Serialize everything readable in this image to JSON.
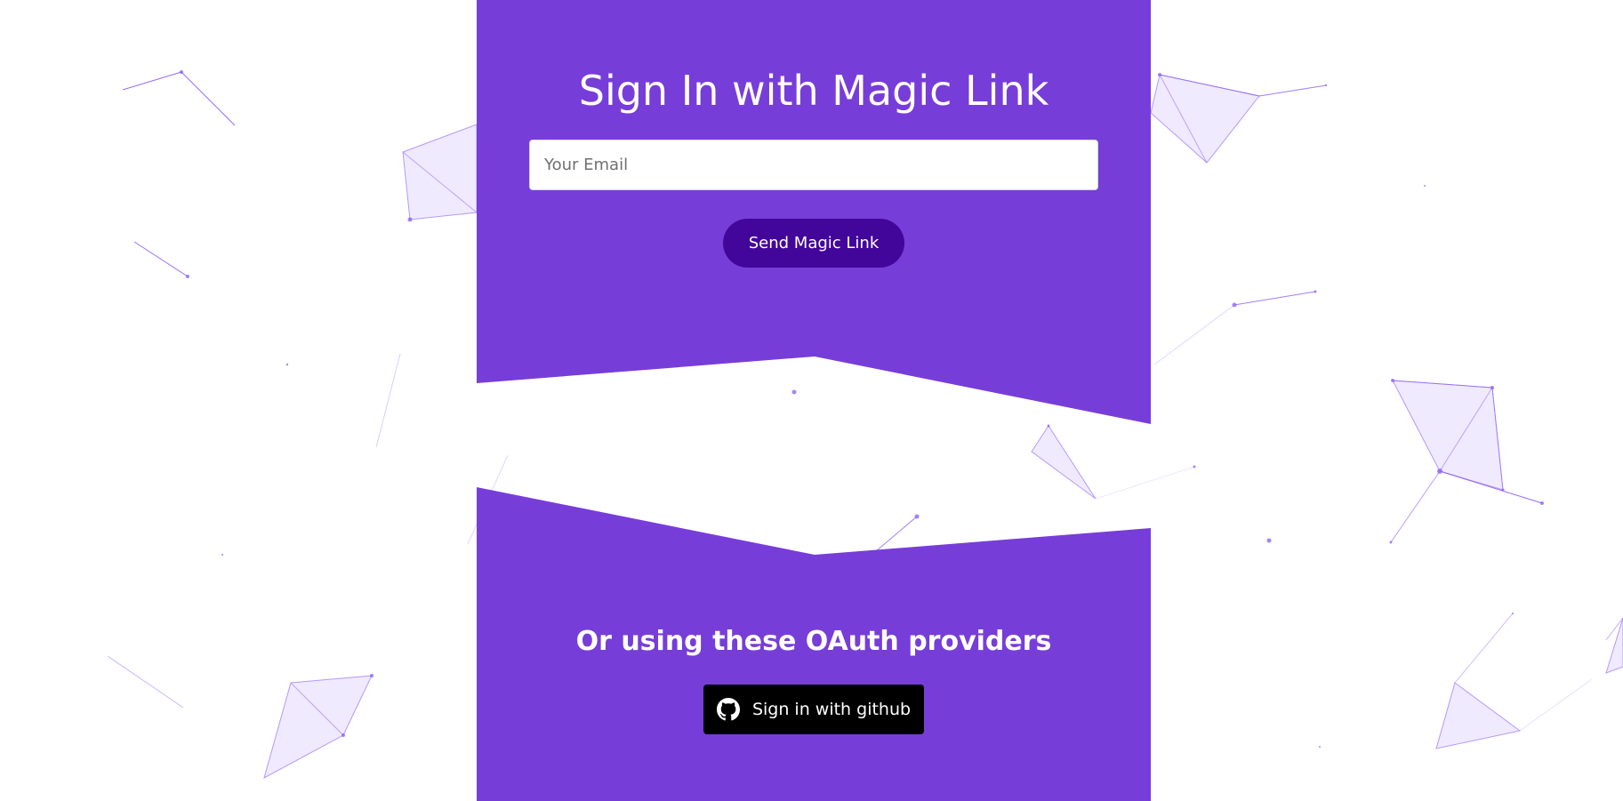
{
  "signin": {
    "title": "Sign In with Magic Link",
    "email_placeholder": "Your Email",
    "email_value": "",
    "submit_label": "Send Magic Link"
  },
  "oauth": {
    "heading": "Or using these OAuth providers",
    "providers": [
      {
        "label": "Sign in with github",
        "icon": "github-icon"
      }
    ]
  },
  "colors": {
    "panel": "#773dd8",
    "submit_button": "#43069a",
    "github_button": "#000000",
    "background": "#ffffff",
    "particles": "#8b5cf6"
  }
}
